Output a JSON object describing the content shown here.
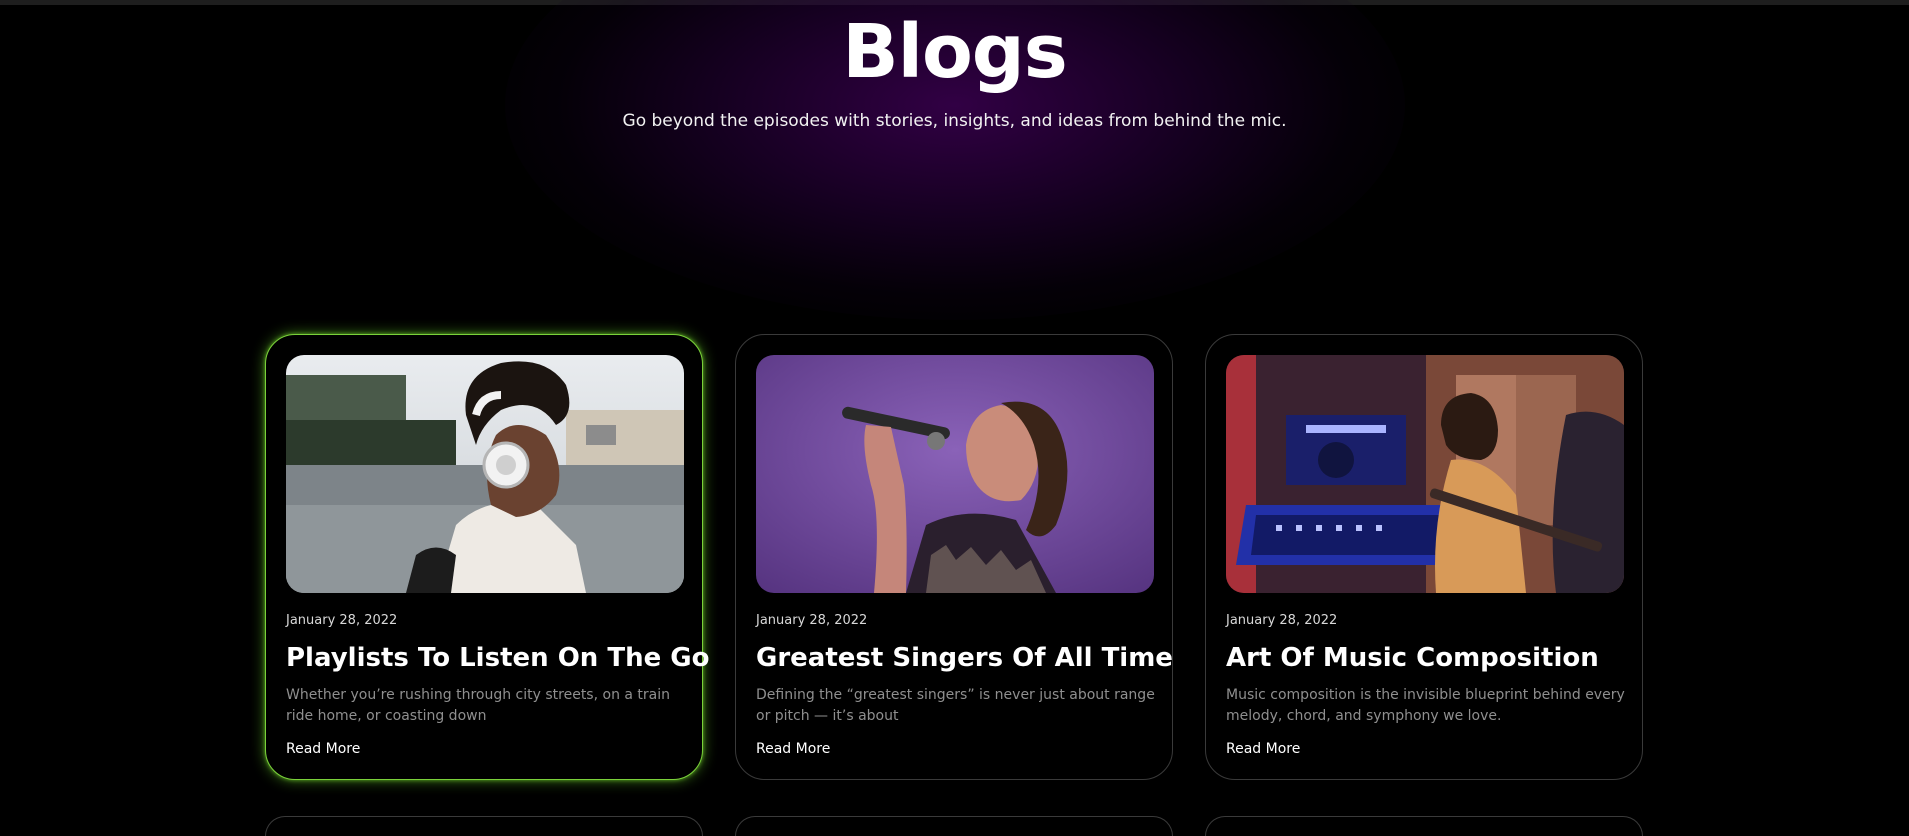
{
  "hero": {
    "title": "Blogs",
    "subtitle": "Go beyond the episodes with stories, insights, and ideas from behind the mic."
  },
  "colors": {
    "background": "#000000",
    "active_border": "#7ad13a",
    "card_border": "#3a3a3a",
    "glow": "#3a0050",
    "excerpt_text": "#8f8f8f"
  },
  "posts": [
    {
      "date": "January 28, 2022",
      "title": "Playlists To Listen On The Go",
      "excerpt": "Whether you’re rushing through city streets, on a train ride home, or coasting down",
      "link_label": "Read More",
      "image_alt": "woman with headphones photo"
    },
    {
      "date": "January 28, 2022",
      "title": "Greatest Singers Of All Time",
      "excerpt": "Defining the “greatest singers” is never just about range or pitch — it’s about",
      "link_label": "Read More",
      "image_alt": "singer with microphone photo"
    },
    {
      "date": "January 28, 2022",
      "title": "Art Of Music Composition",
      "excerpt": "Music composition is the invisible blueprint behind every melody, chord, and symphony we love.",
      "link_label": "Read More",
      "image_alt": "music studio photo"
    }
  ]
}
